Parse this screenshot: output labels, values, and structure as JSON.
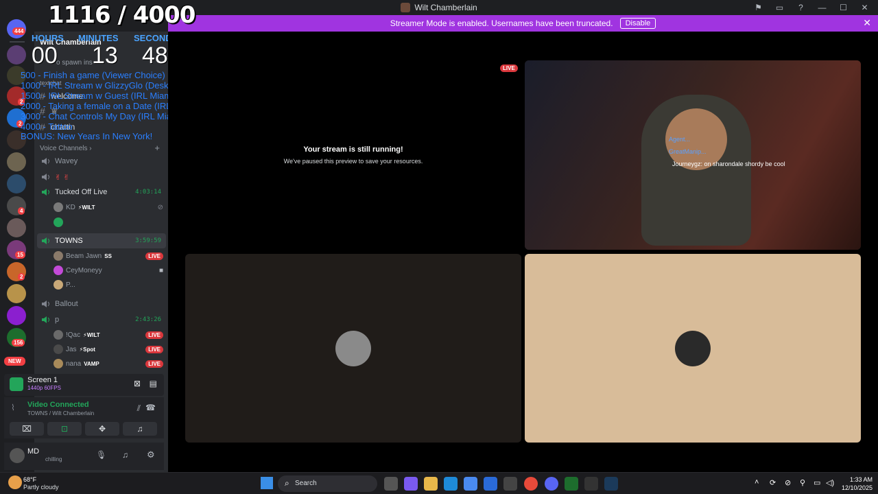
{
  "window": {
    "title": "Wilt Chamberlain",
    "controls": [
      "—",
      "☐",
      "✕"
    ]
  },
  "banner": {
    "text": "Streamer Mode is enabled. Usernames have been truncated.",
    "disable_label": "Disable"
  },
  "overlay": {
    "counter": "1116 / 4000",
    "labels": {
      "hours": "HOURS",
      "minutes": "MINUTES",
      "seconds": "SECONDS"
    },
    "time": {
      "hours": "00",
      "minutes": "13",
      "seconds": "48"
    },
    "goals": [
      "500 - Finish a game (Viewer Choice)",
      "1000 - IRL Stream w GlizzyGlo (Desktop)",
      "1500 - IRL Stream w Guest (IRL Miami)",
      "2000 - Taking a female on a Date (IRL Miami)",
      "3000 - Chat Controls My Day (IRL Miami)",
      "4000 - Tattoo",
      "BONUS: New Years In New York!"
    ]
  },
  "guilds": {
    "badges": [
      "444",
      "2",
      "2",
      "4",
      "15",
      "2",
      "156"
    ],
    "new_label": "NEW"
  },
  "channels": {
    "server_name": "Wilt Chamberlain",
    "spawn_text": "o spawn ins",
    "category_text": "textchat",
    "text_channels": [
      "welcome",
      "chattin"
    ],
    "voice_header": "Voice Channels",
    "voice": [
      {
        "name": "Wavey"
      },
      {
        "name": "✌ ✌"
      },
      {
        "name": "Tucked Off Live",
        "timer": "4:03:14"
      },
      {
        "name": "TOWNS",
        "timer": "3:59:59"
      },
      {
        "name": "Ballout"
      },
      {
        "name": "p",
        "timer": "2:43:26"
      }
    ],
    "users": {
      "kd": {
        "name": "KD",
        "tag": "⚡WILT"
      },
      "beam": {
        "name": "Beam Jawn",
        "tag": "SS",
        "live": "LIVE"
      },
      "cey": {
        "name": "CeyMoneyy"
      },
      "p": {
        "name": "P..."
      },
      "qac": {
        "name": "!Qac",
        "tag": "⚡WILT",
        "live": "LIVE"
      },
      "jas": {
        "name": "Jas",
        "tag": "⚡Spot",
        "live": "LIVE"
      },
      "nana": {
        "name": "nana",
        "tag": "VAMP",
        "live": "LIVE"
      }
    }
  },
  "screen_share": {
    "title": "Screen 1",
    "quality": "1440p 60FPS"
  },
  "voice_status": {
    "status": "Video Connected",
    "location": "TOWNS / Wilt Chamberlain"
  },
  "user_panel": {
    "name": "MD",
    "status": "chilling"
  },
  "stage": {
    "live_badge": "LIVE",
    "paused_title": "Your stream is still running!",
    "paused_sub": "We've paused this preview to save your resources.",
    "chat_lines": [
      {
        "user": "Agent...",
        "text": ""
      },
      {
        "user": "GreatManip...",
        "text": ""
      },
      {
        "user": "Journeygz",
        "text": "on sharondale shordy be cool"
      }
    ]
  },
  "taskbar": {
    "weather_temp": "68°F",
    "weather_desc": "Partly cloudy",
    "search_placeholder": "Search",
    "time": "1:33 AM",
    "date": "12/10/2025"
  },
  "colors": {
    "banner": "#a034e0",
    "sidebar": "#2b2d31",
    "guild_rail": "#1e1f22",
    "live": "#da373c",
    "tile_dark": "#201c19",
    "tile_tan": "#d8bc99"
  }
}
